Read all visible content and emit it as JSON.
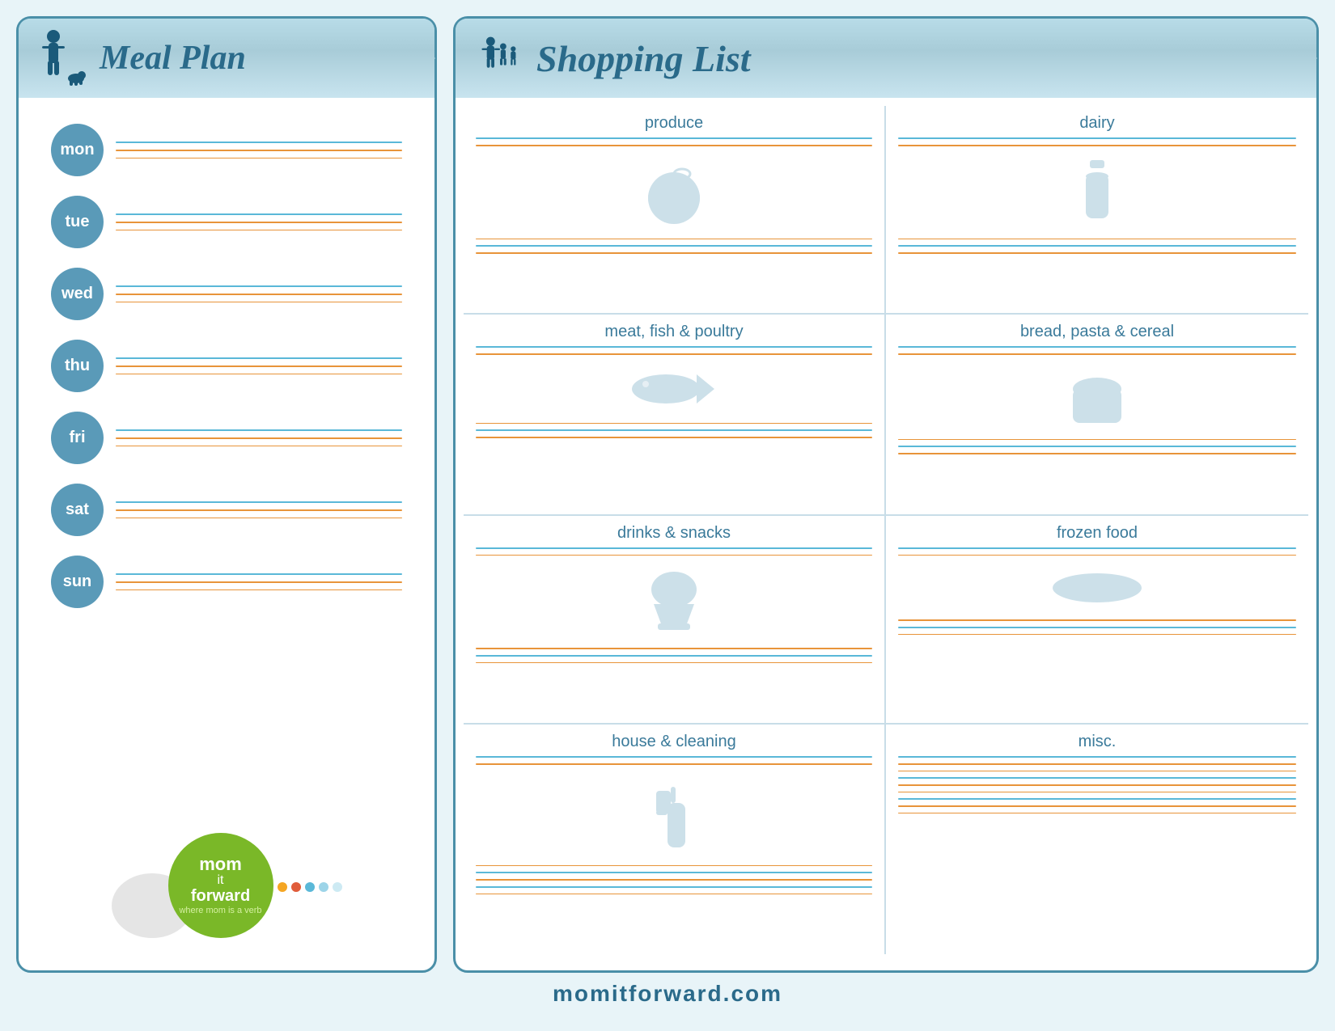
{
  "page": {
    "background_color": "#e8f4f8",
    "footer_url": "momitforward.com",
    "footer_color": "#2a6a8a"
  },
  "meal_plan": {
    "title": "Meal Plan",
    "days": [
      {
        "abbr": "mon"
      },
      {
        "abbr": "tue"
      },
      {
        "abbr": "wed"
      },
      {
        "abbr": "thu"
      },
      {
        "abbr": "fri"
      },
      {
        "abbr": "sat"
      },
      {
        "abbr": "sun"
      }
    ]
  },
  "shopping_list": {
    "title": "Shopping List",
    "sections": [
      {
        "id": "produce",
        "label": "produce",
        "side": "left"
      },
      {
        "id": "dairy",
        "label": "dairy",
        "side": "right"
      },
      {
        "id": "meat",
        "label": "meat, fish & poultry",
        "side": "left"
      },
      {
        "id": "bread",
        "label": "bread, pasta & cereal",
        "side": "right"
      },
      {
        "id": "drinks",
        "label": "drinks & snacks",
        "side": "left"
      },
      {
        "id": "frozen",
        "label": "frozen food",
        "side": "right"
      },
      {
        "id": "house",
        "label": "house & cleaning",
        "side": "left"
      },
      {
        "id": "misc",
        "label": "misc.",
        "side": "right"
      }
    ]
  },
  "logo": {
    "brand_line1": "mom",
    "brand_line2": "it",
    "brand_line3": "forward",
    "tagline": "where mom is a verb",
    "dots": [
      "#f5a623",
      "#e05c3a",
      "#5ab8d8",
      "#5ab8d8",
      "#5ab8d8"
    ]
  }
}
